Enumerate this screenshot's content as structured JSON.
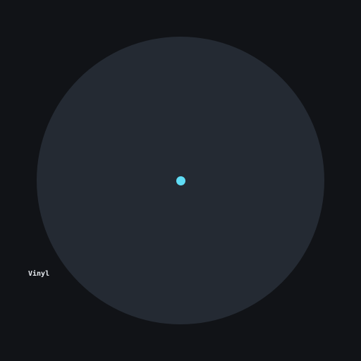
{
  "app": {
    "label": "Vinyl"
  },
  "colors": {
    "background": "#111317",
    "record": "#242a33",
    "accent": "#5fdcf5",
    "label_text": "#e9edf2"
  },
  "icons": {
    "record": "vinyl-record-icon",
    "spindle": "spindle-dot-icon"
  }
}
